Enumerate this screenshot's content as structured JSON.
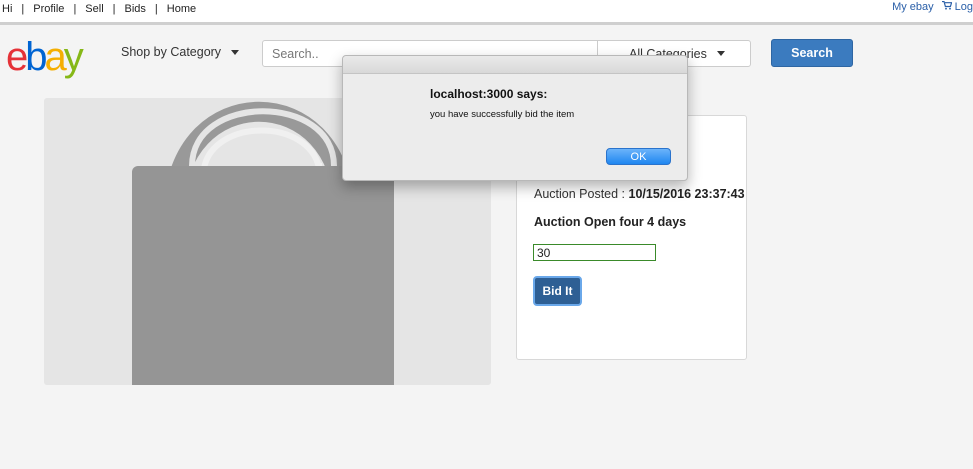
{
  "topnav": {
    "greeting": "Hi",
    "items": [
      {
        "label": "Profile"
      },
      {
        "label": "Sell"
      },
      {
        "label": "Bids"
      },
      {
        "label": "Home"
      }
    ],
    "my_ebay": "My ebay",
    "logout_partial": "Log"
  },
  "header": {
    "logo_letters": [
      "e",
      "b",
      "a",
      "y"
    ],
    "shop_by_category": "Shop by Category",
    "search_placeholder": "Search..",
    "category_select": "All Categories",
    "search_button": "Search"
  },
  "detail": {
    "auction_posted_label": "Auction Posted :",
    "auction_posted_value": "10/15/2016 23:37:43",
    "auction_open": "Auction Open four 4 days",
    "bid_value": "30",
    "bid_button": "Bid It"
  },
  "alert": {
    "title": "localhost:3000 says:",
    "message": "you have successfully bid the item",
    "ok_label": "OK"
  },
  "colors": {
    "ebay_e": "#e53238",
    "ebay_b": "#0064d2",
    "ebay_a": "#f5af02",
    "ebay_y": "#86b817",
    "accent": "#3b7bbf"
  },
  "icons": [
    "cart-icon",
    "caret-down-icon",
    "shopping-bag-icon"
  ]
}
